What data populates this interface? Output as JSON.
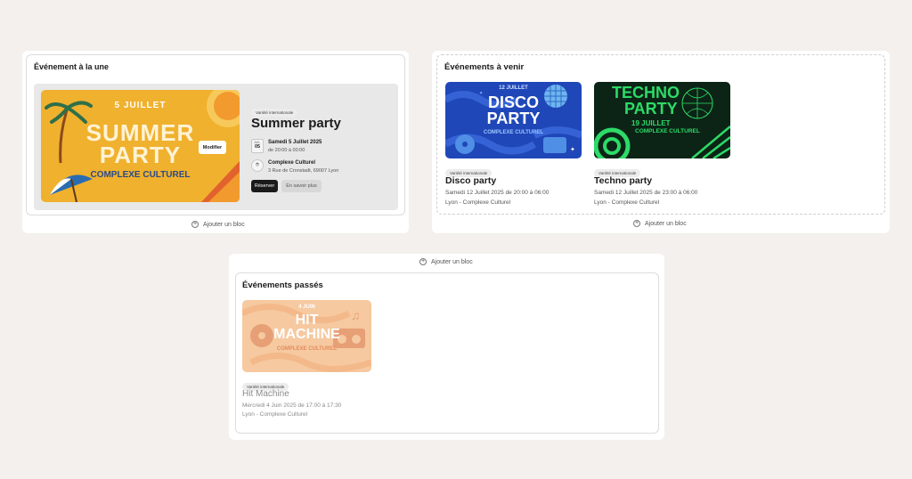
{
  "featured": {
    "section_title": "Événement à la une",
    "poster": {
      "date": "5 JUILLET",
      "line1": "SUMMER",
      "line2": "PARTY",
      "venue": "COMPLEXE CULTUREL"
    },
    "edit_label": "Modifier",
    "tag": "Variété internationale",
    "title": "Summer party",
    "calendar": {
      "month": "JUIL.",
      "day": "05"
    },
    "date_text": "Samedi 5 Juillet 2025",
    "time_text": "de 20:00 à 00:00",
    "venue_name": "Complexe Culturel",
    "address": "3 Rue de Cronstadt, 69007 Lyon",
    "reserve_label": "Réserver",
    "more_label": "En savoir plus",
    "add_block_label": "Ajouter un bloc"
  },
  "upcoming": {
    "section_title": "Événements à venir",
    "events": [
      {
        "poster": {
          "date": "12 JUILLET",
          "line1": "DISCO",
          "line2": "PARTY",
          "venue": "COMPLEXE CULTUREL"
        },
        "tag": "Variété internationale",
        "title": "Disco party",
        "datetime": "Samedi 12 Juillet 2025 de 20:00 à 06:00",
        "location": "Lyon - Complexe Culturel"
      },
      {
        "poster": {
          "date": "19 JUILLET",
          "line1": "TECHNO",
          "line2": "PARTY",
          "venue": "COMPLEXE CULTUREL"
        },
        "tag": "Variété internationale",
        "title": "Techno party",
        "datetime": "Samedi 12 Juillet 2025 de 23:00 à 06:00",
        "location": "Lyon - Complexe Culturel"
      }
    ],
    "add_block_label": "Ajouter un bloc"
  },
  "past": {
    "add_block_label": "Ajouter un bloc",
    "section_title": "Événements passés",
    "events": [
      {
        "poster": {
          "date": "4 JUIN",
          "line1": "HIT",
          "line2": "MACHINE",
          "venue": "COMPLEXE CULTUREL"
        },
        "tag": "Variété internationale",
        "title": "Hit Machine",
        "datetime": "Mercredi 4 Juin 2025 de 17:00 à 17:30",
        "location": "Lyon - Complexe Culturel"
      }
    ]
  },
  "colors": {
    "background": "#f3f0ed",
    "summer_bg": "#f0b12e",
    "disco_bg": "#1f47b8",
    "techno_bg": "#0c2416",
    "techno_text": "#2ddb68",
    "hit_bg": "#f6c9a0",
    "button_dark": "#1a1a1a"
  }
}
